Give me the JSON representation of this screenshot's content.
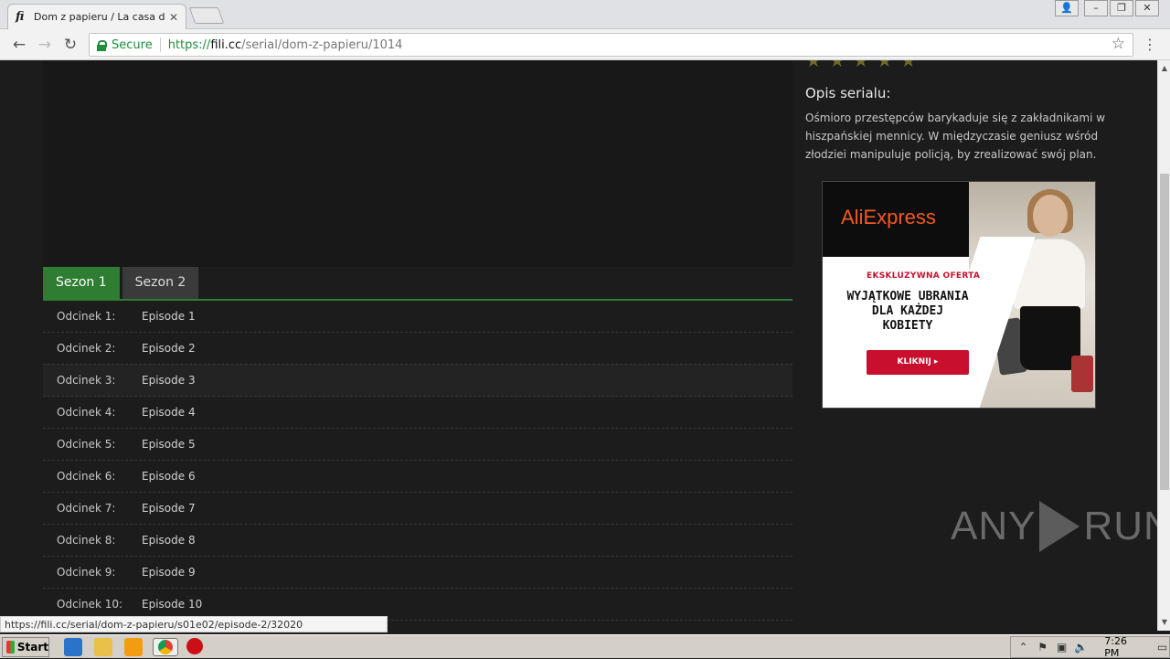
{
  "browser": {
    "tab_title": "Dom z papieru / La casa de p",
    "tab_favicon": "fi",
    "secure_label": "Secure",
    "url_scheme": "https://",
    "url_host": "fili.cc",
    "url_path": "/serial/dom-z-papieru/1014",
    "status_url": "https://fili.cc/serial/dom-z-papieru/s01e02/episode-2/32020"
  },
  "seasons": [
    {
      "label": "Sezon 1",
      "active": true
    },
    {
      "label": "Sezon 2",
      "active": false
    }
  ],
  "episodes": [
    {
      "num": "Odcinek 1:",
      "title": "Episode 1"
    },
    {
      "num": "Odcinek 2:",
      "title": "Episode 2"
    },
    {
      "num": "Odcinek 3:",
      "title": "Episode 3"
    },
    {
      "num": "Odcinek 4:",
      "title": "Episode 4"
    },
    {
      "num": "Odcinek 5:",
      "title": "Episode 5"
    },
    {
      "num": "Odcinek 6:",
      "title": "Episode 6"
    },
    {
      "num": "Odcinek 7:",
      "title": "Episode 7"
    },
    {
      "num": "Odcinek 8:",
      "title": "Episode 8"
    },
    {
      "num": "Odcinek 9:",
      "title": "Episode 9"
    },
    {
      "num": "Odcinek 10:",
      "title": "Episode 10"
    }
  ],
  "sidebar": {
    "description_title": "Opis serialu:",
    "description_text": "Ośmioro przestępców barykaduje się z zakładnikami w hiszpańskiej mennicy. W międzyczasie geniusz wśród złodziei manipuluje policją, by zrealizować swój plan."
  },
  "ad": {
    "brand": "AliExpress",
    "kicker": "EKSKLUZYWNA OFERTA",
    "headline_1": "WYJĄTKOWE UBRANIA",
    "headline_2": "DLA KAŻDEJ",
    "headline_3": "KOBIETY",
    "cta": "KLIKNIJ ▸"
  },
  "watermark": {
    "left": "ANY",
    "right": "RUN"
  },
  "taskbar": {
    "start_label": "Start",
    "clock": "7:26 PM"
  },
  "colors": {
    "accent": "#2e7d32",
    "ad_red": "#c8102e",
    "brand_orange": "#f05a22"
  }
}
